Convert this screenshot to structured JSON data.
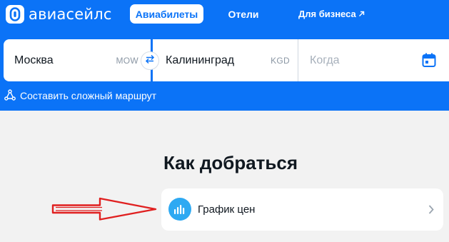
{
  "header": {
    "logo_text": "авиасейлс",
    "logo_icon": "aviasales-logo-icon",
    "tabs": [
      {
        "label": "Авиабилеты",
        "active": true
      },
      {
        "label": "Отели",
        "active": false
      }
    ],
    "business_link": {
      "label": "Для бизнеса",
      "icon": "external-arrow-icon"
    }
  },
  "search": {
    "origin": {
      "city": "Москва",
      "iata": "MOW"
    },
    "destination": {
      "city": "Калининград",
      "iata": "KGD"
    },
    "date": {
      "placeholder": "Когда",
      "icon": "calendar-icon"
    },
    "swap_icon": "swap-arrows-icon",
    "complex_route": {
      "label": "Составить сложный маршрут",
      "icon": "route-icon"
    }
  },
  "main": {
    "section_title": "Как добраться",
    "cards": [
      {
        "label": "График цен",
        "icon": "price-chart-icon",
        "chevron": "chevron-right-icon"
      }
    ]
  },
  "annotation": {
    "icon": "red-arrow-annotation",
    "color": "#e02020"
  },
  "colors": {
    "brand": "#0b73f7",
    "background": "#f2f2f2",
    "card": "#ffffff",
    "chart_icon": "#2ea9f2"
  }
}
